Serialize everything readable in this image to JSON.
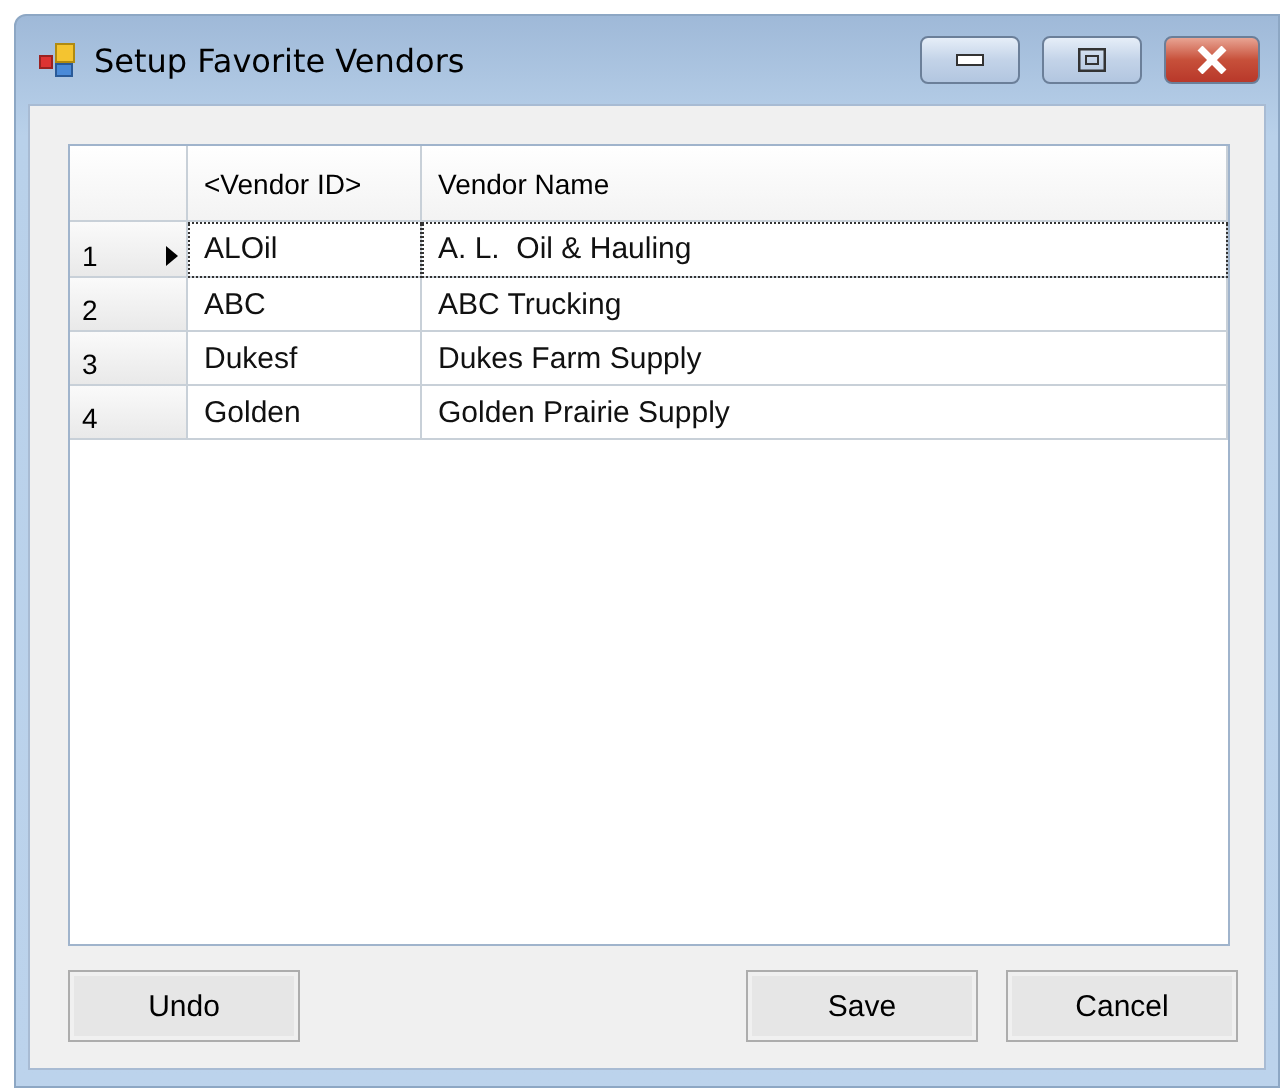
{
  "window": {
    "title": "Setup Favorite Vendors"
  },
  "table": {
    "columns": [
      "<Vendor ID>",
      "Vendor Name"
    ],
    "rows": [
      {
        "number": "1",
        "vendor_id": "ALOil",
        "vendor_name": "A. L.  Oil & Hauling",
        "selected": true
      },
      {
        "number": "2",
        "vendor_id": "ABC",
        "vendor_name": "ABC Trucking",
        "selected": false
      },
      {
        "number": "3",
        "vendor_id": "Dukesf",
        "vendor_name": "Dukes Farm Supply",
        "selected": false
      },
      {
        "number": "4",
        "vendor_id": "Golden",
        "vendor_name": "Golden Prairie Supply",
        "selected": false
      }
    ]
  },
  "buttons": [
    {
      "label": "Undo",
      "kind": "left"
    },
    {
      "label": "Save",
      "kind": "right"
    },
    {
      "label": "Cancel",
      "kind": "right"
    }
  ]
}
